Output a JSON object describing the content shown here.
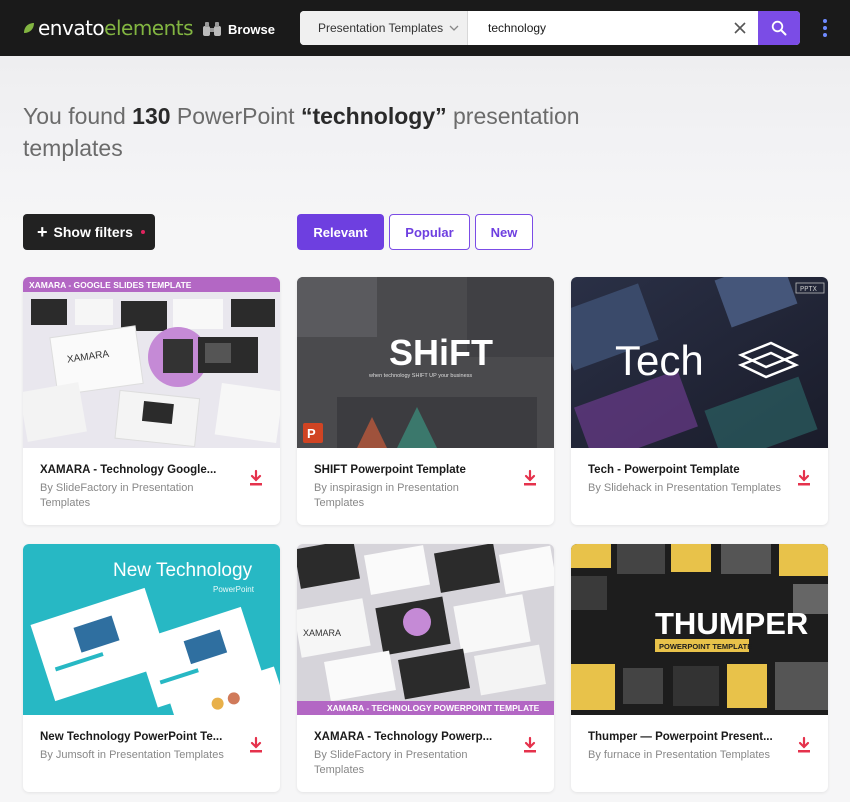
{
  "header": {
    "logo_part1": "envato",
    "logo_part2": "elements",
    "browse_label": "Browse",
    "category_label": "Presentation Templates",
    "search_value": "technology",
    "accent": "#7b4ce6",
    "brand_green": "#82b541"
  },
  "hero": {
    "prefix": "You found ",
    "count": "130",
    "middle": " PowerPoint ",
    "query": "“technology”",
    "suffix": " presentation templates"
  },
  "controls": {
    "filters_label": "Show filters",
    "sort_options": [
      "Relevant",
      "Popular",
      "New"
    ],
    "sort_active": "Relevant"
  },
  "cards": [
    {
      "title": "XAMARA - Technology Google...",
      "meta": "By SlideFactory in Presentation Templates",
      "banner": "XAMARA - GOOGLE SLIDES TEMPLATE",
      "label": "XAMARA"
    },
    {
      "title": "SHIFT Powerpoint Template",
      "meta": "By inspirasign in Presentation Templates",
      "banner": "SHiFT",
      "label": "when technology SHIFT UP your business"
    },
    {
      "title": "Tech - Powerpoint Template",
      "meta": "By Slidehack in Presentation Templates",
      "banner": "Tech",
      "label": "PPTX"
    },
    {
      "title": "New Technology PowerPoint Te...",
      "meta": "By Jumsoft in Presentation Templates",
      "banner": "New Technology",
      "label": "PowerPoint"
    },
    {
      "title": "XAMARA - Technology Powerp...",
      "meta": "By SlideFactory in Presentation Templates",
      "banner": "XAMARA - TECHNOLOGY POWERPOINT TEMPLATE",
      "label": "XAMARA"
    },
    {
      "title": "Thumper — Powerpoint Present...",
      "meta": "By furnace in Presentation Templates",
      "banner": "THUMPER",
      "label": "POWERPOINT TEMPLATE"
    }
  ]
}
